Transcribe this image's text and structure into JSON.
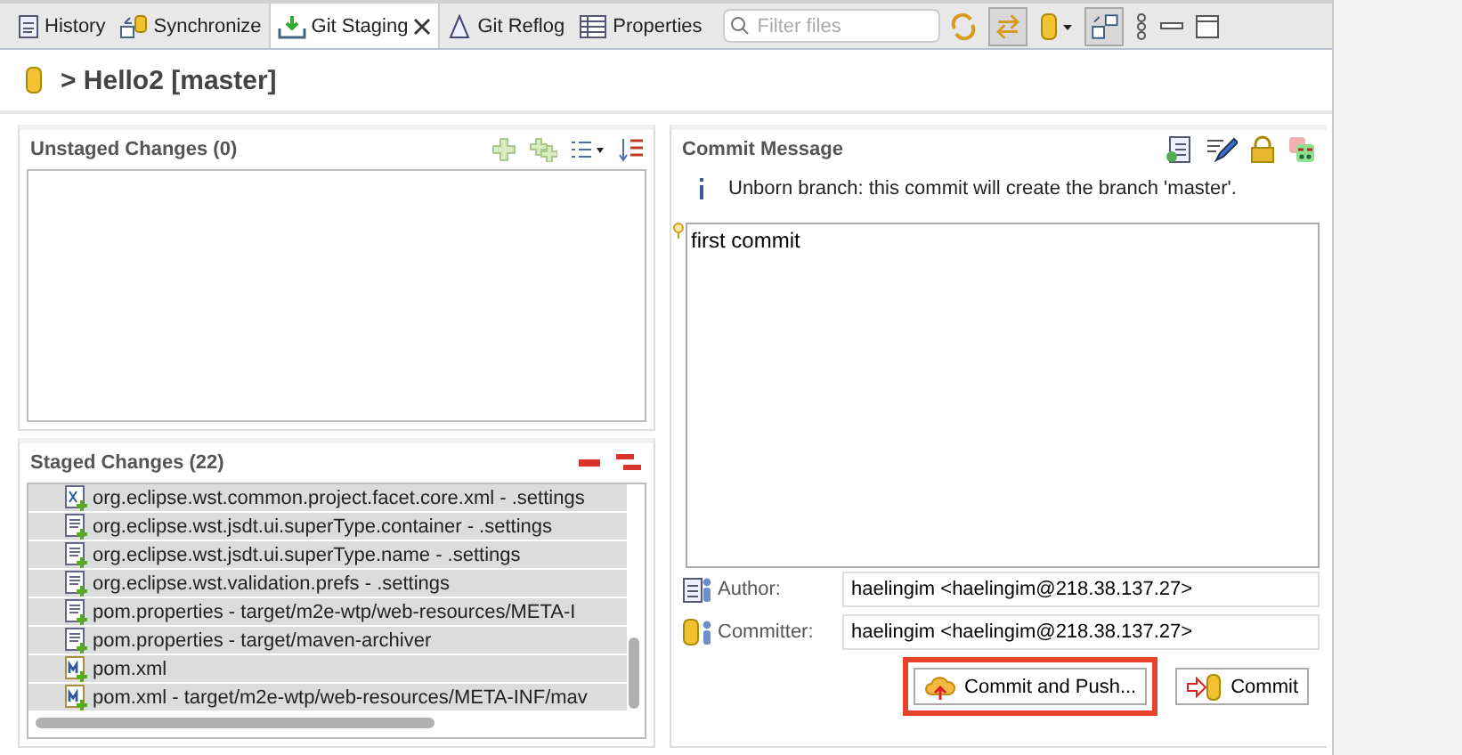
{
  "tabs": [
    {
      "label": "History",
      "selected": false
    },
    {
      "label": "Synchronize",
      "selected": false
    },
    {
      "label": "Git Staging",
      "selected": true
    },
    {
      "label": "Git Reflog",
      "selected": false
    },
    {
      "label": "Properties",
      "selected": false
    }
  ],
  "filter": {
    "placeholder": "Filter files"
  },
  "repository": {
    "title": "> Hello2 [master]"
  },
  "unstaged": {
    "title": "Unstaged Changes (0)"
  },
  "staged": {
    "title": "Staged Changes (22)",
    "files": [
      {
        "name": "org.eclipse.wst.common.project.facet.core.xml - .settings",
        "kind": "xml",
        "selected": true
      },
      {
        "name": "org.eclipse.wst.jsdt.ui.superType.container - .settings",
        "kind": "file",
        "selected": true
      },
      {
        "name": "org.eclipse.wst.jsdt.ui.superType.name - .settings",
        "kind": "file",
        "selected": true
      },
      {
        "name": "org.eclipse.wst.validation.prefs - .settings",
        "kind": "file",
        "selected": true
      },
      {
        "name": "pom.properties - target/m2e-wtp/web-resources/META-I",
        "kind": "file",
        "selected": true
      },
      {
        "name": "pom.properties - target/maven-archiver",
        "kind": "file",
        "selected": true
      },
      {
        "name": "pom.xml",
        "kind": "maven",
        "selected": true
      },
      {
        "name": "pom.xml - target/m2e-wtp/web-resources/META-INF/mav",
        "kind": "maven",
        "selected": true
      }
    ]
  },
  "commit": {
    "title": "Commit Message",
    "info": "Unborn branch: this commit will create the branch 'master'.",
    "message": "first commit",
    "author_label": "Author:",
    "author": "haelingim <haelingim@218.38.137.27>",
    "committer_label": "Committer:",
    "committer": "haelingim <haelingim@218.38.137.27>"
  },
  "buttons": [
    {
      "label": "Commit and Push...",
      "kind": "push",
      "highlighted": true
    },
    {
      "label": "Commit",
      "kind": "commit",
      "highlighted": false
    }
  ]
}
